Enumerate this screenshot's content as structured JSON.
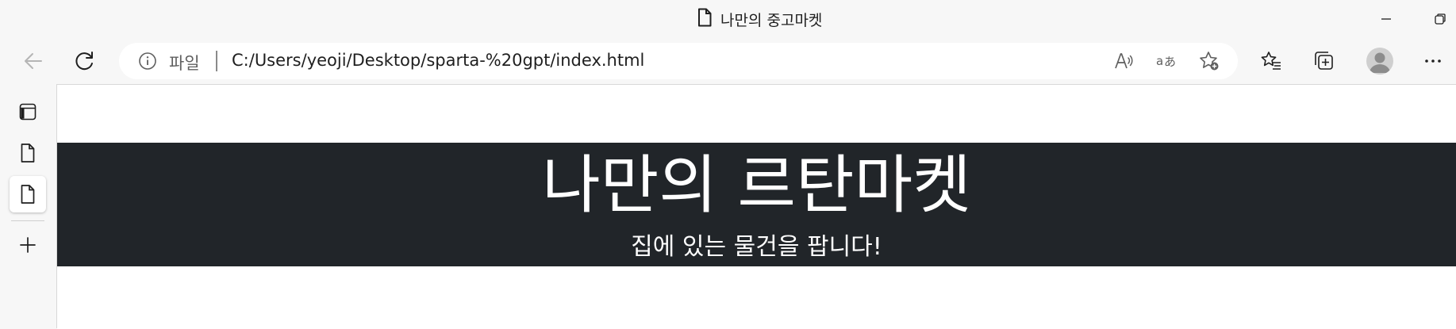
{
  "window": {
    "title": "나만의 중고마켓",
    "icons": [
      "page-icon",
      "minimize-icon",
      "restore-icon"
    ]
  },
  "toolbar": {
    "icons": [
      "back-icon",
      "refresh-icon",
      "read-aloud-icon",
      "translate-icon",
      "add-favorite-icon",
      "favorites-icon",
      "collections-icon",
      "profile-icon",
      "more-icon"
    ],
    "address": {
      "protocol_label": "파일",
      "url": "C:/Users/yeoji/Desktop/sparta-%20gpt/index.html"
    }
  },
  "sidebar": {
    "items": [
      {
        "name": "tab-actions-icon"
      },
      {
        "name": "tab-page-icon"
      },
      {
        "name": "tab-page-icon",
        "active": true
      },
      {
        "name": "add-tab-icon"
      }
    ]
  },
  "page": {
    "hero_title": "나만의 르탄마켓",
    "hero_subtitle": "집에 있는 물건을 팝니다!",
    "colors": {
      "hero_bg": "#212529",
      "hero_text": "#ffffff"
    }
  }
}
